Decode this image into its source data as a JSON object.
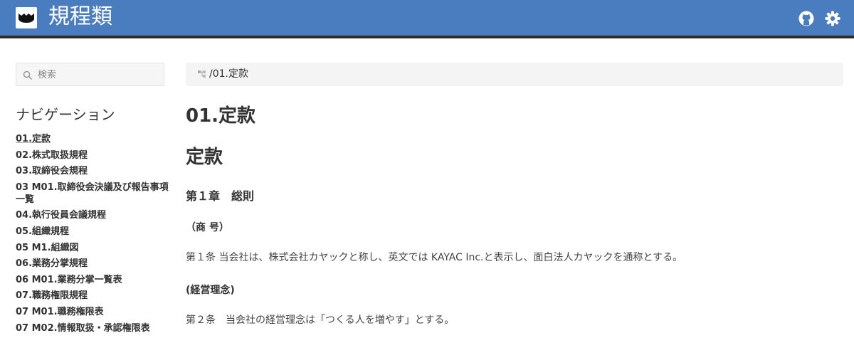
{
  "header": {
    "title": "規程類",
    "icons": [
      "github-icon",
      "gear-icon"
    ],
    "bg_color": "#4a7cc0"
  },
  "search": {
    "placeholder": "検索"
  },
  "sidebar": {
    "title": "ナビゲーション",
    "items": [
      {
        "label": "01.定款",
        "active": true
      },
      {
        "label": "02.株式取扱規程"
      },
      {
        "label": "03.取締役会規程"
      },
      {
        "label": "03 M01.取締役会決議及び報告事項一覧"
      },
      {
        "label": "04.執行役員会議規程"
      },
      {
        "label": "05.組織規程"
      },
      {
        "label": "05 M1.組織図"
      },
      {
        "label": "06.業務分掌規程"
      },
      {
        "label": "06 M01.業務分掌一覧表"
      },
      {
        "label": "07.職務権限規程"
      },
      {
        "label": "07 M01.職務権限表"
      },
      {
        "label": "07 M02.情報取扱・承認権限表"
      }
    ]
  },
  "breadcrumb": {
    "text": "/01.定款",
    "icon": "tree-icon"
  },
  "content": {
    "page_title": "01.定款",
    "doc_title": "定款",
    "chapter": "第１章　総則",
    "section1_title": "（商 号）",
    "section1_text": "第１条 当会社は、株式会社カヤックと称し、英文では KAYAC Inc.と表示し、面白法人カヤックを通称とする。",
    "section2_title": "(経営理念)",
    "section2_text": "第２条　当会社の経営理念は「つくる人を増やす」とする。"
  }
}
